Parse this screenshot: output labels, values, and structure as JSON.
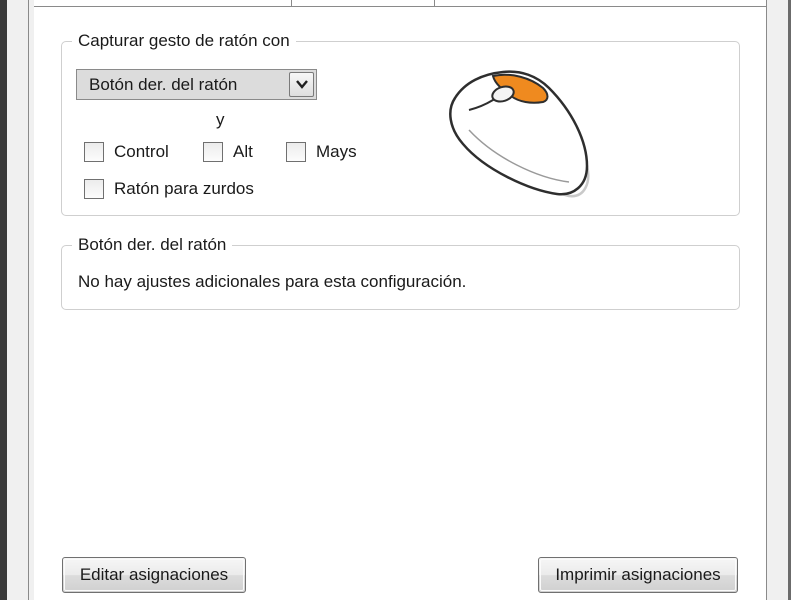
{
  "capture_group": {
    "title": "Capturar gesto de ratón con",
    "button_select": {
      "selected": "Botón der. del ratón",
      "arrow_icon": "chevron-down-icon"
    },
    "conjunction": "y",
    "modifiers": [
      {
        "label": "Control",
        "checked": false
      },
      {
        "label": "Alt",
        "checked": false
      },
      {
        "label": "Mays",
        "checked": false
      }
    ],
    "left_handed": {
      "label": "Ratón para zurdos",
      "checked": false
    },
    "mouse_illustration": {
      "icon": "mouse-right-button-icon",
      "highlight_color": "#ef8a1f"
    }
  },
  "settings_group": {
    "title": "Botón der. del ratón",
    "message": "No hay ajustes adicionales para esta configuración."
  },
  "footer": {
    "edit_label": "Editar asignaciones",
    "print_label": "Imprimir asignaciones"
  }
}
